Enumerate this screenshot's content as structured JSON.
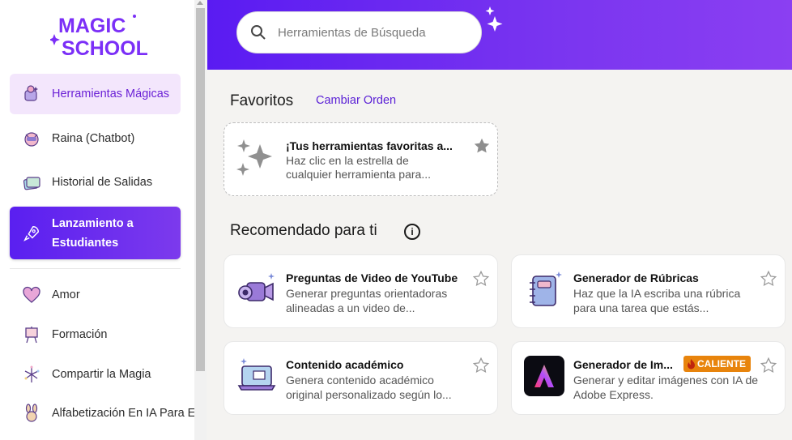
{
  "sidebar": {
    "logo_text": "MAGIC SCHOOL",
    "items": [
      {
        "label": "Herramientas Mágicas",
        "icon": "magic-tools-icon"
      },
      {
        "label": "Raina (Chatbot)",
        "icon": "raina-chatbot-icon"
      },
      {
        "label": "Historial de Salidas",
        "icon": "history-icon"
      },
      {
        "label": "Lanzamiento a Estudiantes",
        "icon": "rocket-icon"
      },
      {
        "label": "Amor",
        "icon": "heart-icon"
      },
      {
        "label": "Formación",
        "icon": "easel-icon"
      },
      {
        "label": "Compartir la Magia",
        "icon": "fireworks-icon"
      },
      {
        "label": "Alfabetización En IA Para E",
        "icon": "bunny-icon"
      }
    ]
  },
  "search": {
    "placeholder": "Herramientas de Búsqueda"
  },
  "favorites": {
    "title": "Favoritos",
    "change_order": "Cambiar Orden",
    "empty_title": "¡Tus herramientas favoritas a...",
    "empty_desc": "Haz clic en la estrella de cualquier herramienta para..."
  },
  "recommended": {
    "title": "Recomendado para ti",
    "cards": [
      {
        "title": "Preguntas de Video de YouTube",
        "desc": "Generar preguntas orientadoras alineadas a un video de...",
        "icon": "video-camera-icon"
      },
      {
        "title": "Generador de Rúbricas",
        "desc": "Haz que la IA escriba una rúbrica para una tarea que estás...",
        "icon": "notebook-icon"
      },
      {
        "title": "Contenido académico",
        "desc": "Genera contenido académico original personalizado según lo...",
        "icon": "laptop-icon"
      },
      {
        "title": "Generador de Im...",
        "desc": "Generar y editar imágenes con IA de Adobe Express.",
        "icon": "adobe-express-icon",
        "badge": "CALIENTE"
      }
    ]
  },
  "colors": {
    "accent": "#5a1ff0",
    "badge": "#e8840c"
  }
}
